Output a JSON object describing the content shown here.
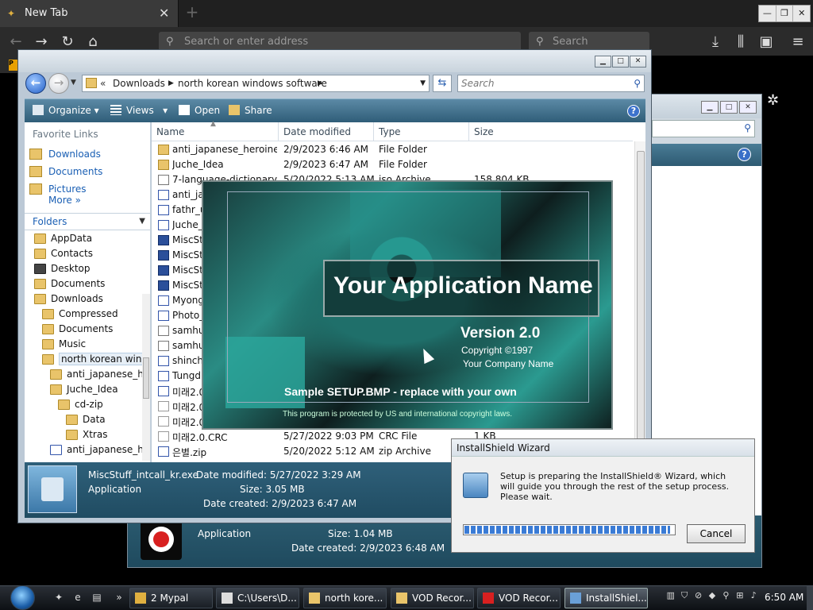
{
  "browser": {
    "tab_title": "New Tab",
    "tab_close": "✕",
    "new_tab": "+",
    "url_placeholder": "Search or enter address",
    "search_placeholder": "Search",
    "win_controls": [
      "—",
      "❐",
      "✕"
    ]
  },
  "explorer": {
    "address": {
      "chevron": "«",
      "segments": [
        "Downloads",
        "north korean windows software"
      ]
    },
    "search_placeholder": "Search",
    "toolbar": {
      "organize": "Organize",
      "views": "Views",
      "open": "Open",
      "share": "Share",
      "help": "?"
    },
    "favorites": {
      "header": "Favorite Links",
      "items": [
        "Downloads",
        "Documents",
        "Pictures"
      ],
      "more": "More"
    },
    "folders_label": "Folders",
    "tree": [
      {
        "label": "AppData",
        "icon": "folder"
      },
      {
        "label": "Contacts",
        "icon": "folder"
      },
      {
        "label": "Desktop",
        "icon": "desktop"
      },
      {
        "label": "Documents",
        "icon": "folder"
      },
      {
        "label": "Downloads",
        "icon": "folder"
      },
      {
        "label": "Compressed",
        "icon": "folder"
      },
      {
        "label": "Documents",
        "icon": "folder"
      },
      {
        "label": "Music",
        "icon": "folder"
      },
      {
        "label": "north korean wind",
        "icon": "folder"
      },
      {
        "label": "anti_japanese_he",
        "icon": "folder"
      },
      {
        "label": "Juche_Idea",
        "icon": "folder"
      },
      {
        "label": "cd-zip",
        "icon": "folder"
      },
      {
        "label": "Data",
        "icon": "folder"
      },
      {
        "label": "Xtras",
        "icon": "folder"
      },
      {
        "label": "anti_japanese_he",
        "icon": "zip"
      }
    ],
    "columns": [
      "Name",
      "Date modified",
      "Type",
      "Size"
    ],
    "files": [
      {
        "name": "anti_japanese_heroine",
        "date": "2/9/2023 6:46 AM",
        "type": "File Folder",
        "size": "",
        "icon": "folder"
      },
      {
        "name": "Juche_Idea",
        "date": "2/9/2023 6:47 AM",
        "type": "File Folder",
        "size": "",
        "icon": "folder"
      },
      {
        "name": "7-language-dictionary",
        "date": "5/20/2022 5:13 AM",
        "type": "iso Archive",
        "size": "158,804 KB",
        "icon": "iso"
      },
      {
        "name": "anti_japanese",
        "date": "",
        "type": "",
        "size": "",
        "icon": "zip"
      },
      {
        "name": "fathr_u",
        "date": "",
        "type": "",
        "size": "",
        "icon": "zip"
      },
      {
        "name": "Juche_I",
        "date": "",
        "type": "",
        "size": "",
        "icon": "zip"
      },
      {
        "name": "MiscSt",
        "date": "",
        "type": "",
        "size": "",
        "icon": "exe"
      },
      {
        "name": "MiscSt",
        "date": "",
        "type": "",
        "size": "",
        "icon": "exe"
      },
      {
        "name": "MiscSt",
        "date": "",
        "type": "",
        "size": "",
        "icon": "exe"
      },
      {
        "name": "MiscSt",
        "date": "",
        "type": "",
        "size": "",
        "icon": "exe"
      },
      {
        "name": "Myong",
        "date": "",
        "type": "",
        "size": "",
        "icon": "zip"
      },
      {
        "name": "Photo_",
        "date": "",
        "type": "",
        "size": "",
        "icon": "zip"
      },
      {
        "name": "samhu",
        "date": "",
        "type": "",
        "size": "",
        "icon": "iso"
      },
      {
        "name": "samhu",
        "date": "",
        "type": "",
        "size": "",
        "icon": "iso"
      },
      {
        "name": "shinch",
        "date": "",
        "type": "",
        "size": "",
        "icon": "zip"
      },
      {
        "name": "Tungd",
        "date": "",
        "type": "",
        "size": "",
        "icon": "zip"
      },
      {
        "name": "미래2.0",
        "date": "",
        "type": "",
        "size": "",
        "icon": "zip"
      },
      {
        "name": "미래2.0",
        "date": "",
        "type": "",
        "size": "",
        "icon": "blank"
      },
      {
        "name": "미래2.0",
        "date": "",
        "type": "",
        "size": "",
        "icon": "blank"
      },
      {
        "name": "미래2.0.CRC",
        "date": "5/27/2022 9:03 PM",
        "type": "CRC File",
        "size": "1 KB",
        "icon": "blank"
      },
      {
        "name": "은별.zip",
        "date": "5/20/2022 5:12 AM",
        "type": "zip Archive",
        "size": "",
        "icon": "zip"
      }
    ],
    "details": {
      "filename": "MiscStuff_intcall_kr.exe",
      "type": "Application",
      "modified_label": "Date modified:",
      "modified": "5/27/2022 3:29 AM",
      "size_label": "Size:",
      "size": "3.05 MB",
      "created_label": "Date created:",
      "created": "2/9/2023 6:47 AM"
    }
  },
  "back_window": {
    "details": {
      "type": "Application",
      "size_label": "Size:",
      "size": "1.04 MB",
      "created_label": "Date created:",
      "created": "2/9/2023 6:48 AM"
    }
  },
  "splash": {
    "app_name": "Your Application Name",
    "version": "Version 2.0",
    "copyright": "Copyright ©1997",
    "company": "Your Company Name",
    "sample": "Sample SETUP.BMP - replace with your own",
    "legal": "This program is protected by US and international copyright laws."
  },
  "installshield": {
    "title": "InstallShield Wizard",
    "message": "Setup is preparing the InstallShield® Wizard, which will guide you through the rest of the setup process. Please wait.",
    "progress": 0.98,
    "cancel": "Cancel"
  },
  "taskbar": {
    "tasks": [
      {
        "label": "2 Mypal",
        "active": false
      },
      {
        "label": "C:\\Users\\D...",
        "active": false
      },
      {
        "label": "north kore...",
        "active": false
      },
      {
        "label": "VOD Recor...",
        "active": false
      },
      {
        "label": "VOD Recor...",
        "active": false
      },
      {
        "label": "InstallShiel...",
        "active": true
      }
    ],
    "clock": "6:50 AM"
  }
}
